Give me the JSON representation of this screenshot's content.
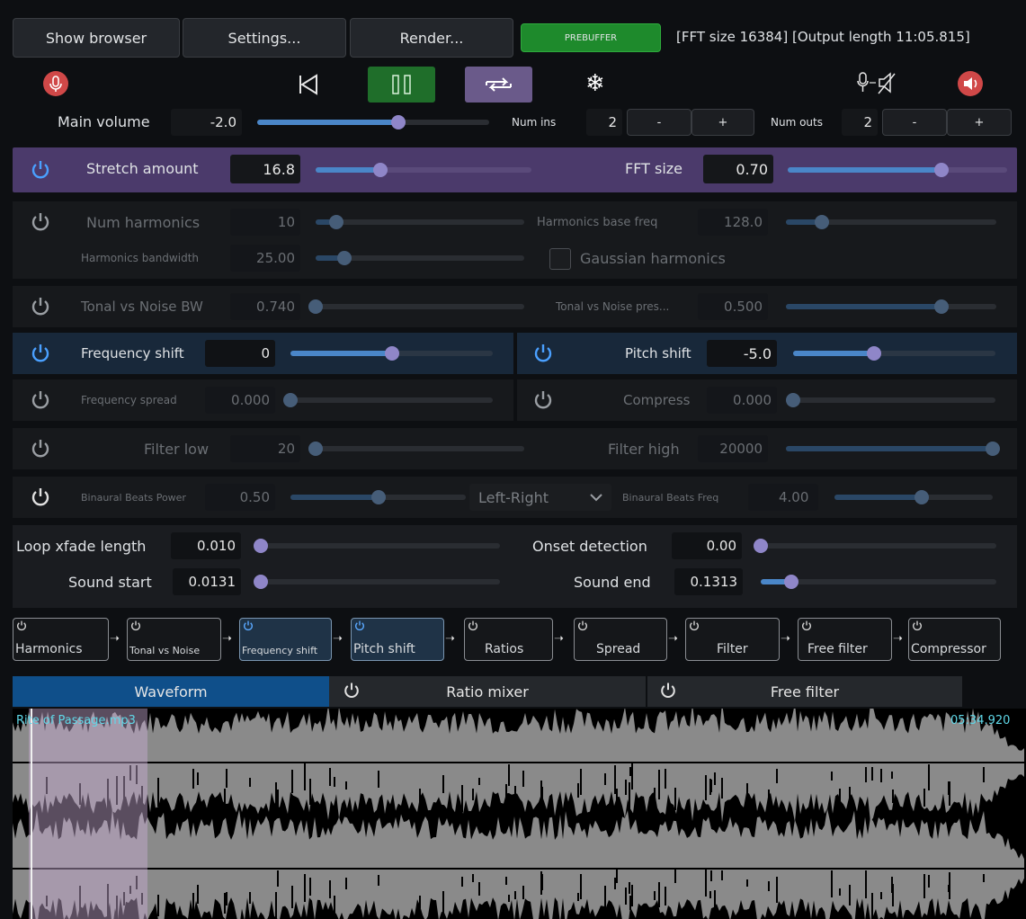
{
  "toolbar": {
    "show_browser": "Show browser",
    "settings": "Settings...",
    "render": "Render...",
    "prebuffer": "PREBUFFER",
    "status": "[FFT size 16384] [Output length 11:05.815]"
  },
  "colors": {
    "accent_blue": "#4a86c8",
    "thumb": "#8f86c8",
    "prebuffer_green": "#1e8a2c",
    "header_purple": "#4b3a6b",
    "play_green": "#1f6e2a",
    "loop_purple": "#6a5a8a",
    "waveform_grey": "#8a8a8a",
    "red_icon": "#e05050"
  },
  "transport": {
    "mic_icon": "mic-record-icon",
    "rewind_icon": "skip-back-icon",
    "pause_icon": "pause-icon",
    "loop_icon": "loop-icon",
    "freeze_icon": "snowflake-icon",
    "pass_icon": "mic-to-speaker-icon",
    "mute_icon": "speaker-icon"
  },
  "volume": {
    "label": "Main volume",
    "value": "-2.0",
    "level": 0.61
  },
  "ins": {
    "label": "Num ins",
    "value": "2",
    "minus": "-",
    "plus": "+"
  },
  "outs": {
    "label": "Num outs",
    "value": "2",
    "minus": "-",
    "plus": "+"
  },
  "stretch": {
    "label": "Stretch amount",
    "value": "16.8",
    "level": 0.3
  },
  "fft": {
    "label": "FFT size",
    "value": "0.70",
    "level": 0.7
  },
  "harmonics": {
    "num_label": "Num harmonics",
    "num_value": "10",
    "num_level": 0.1,
    "base_label": "Harmonics base freq",
    "base_value": "128.0",
    "base_level": 0.17,
    "bw_label": "Harmonics bandwidth",
    "bw_value": "25.00",
    "bw_level": 0.14,
    "gauss_label": "Gaussian harmonics"
  },
  "tonal": {
    "bw_label": "Tonal vs Noise BW",
    "bw_value": "0.740",
    "bw_level": 0.0,
    "pres_label": "Tonal vs Noise pres...",
    "pres_value": "0.500",
    "pres_level": 0.74
  },
  "freqshift": {
    "label": "Frequency shift",
    "value": "0",
    "level": 0.5
  },
  "pitchshift": {
    "label": "Pitch shift",
    "value": "-5.0",
    "level": 0.4
  },
  "spread": {
    "label": "Frequency spread",
    "value": "0.000",
    "level": 0.0
  },
  "compress": {
    "label": "Compress",
    "value": "0.000",
    "level": 0.0
  },
  "filter": {
    "low_label": "Filter low",
    "low_value": "20",
    "low_level": 0.0,
    "high_label": "Filter high",
    "high_value": "20000",
    "high_level": 1.0
  },
  "binaural": {
    "power_label": "Binaural Beats Power",
    "power_value": "0.50",
    "power_level": 0.5,
    "mode": "Left-Right",
    "freq_label": "Binaural Beats Freq",
    "freq_value": "4.00",
    "freq_level": 0.55
  },
  "loop": {
    "xfade_label": "Loop xfade length",
    "xfade_value": "0.010",
    "xfade_level": 0.0,
    "onset_label": "Onset detection",
    "onset_value": "0.00",
    "onset_level": 0.0,
    "start_label": "Sound start",
    "start_value": "0.0131",
    "start_level": 0.0,
    "end_label": "Sound end",
    "end_value": "0.1313",
    "end_level": 0.13
  },
  "chain": [
    "Harmonics",
    "Tonal vs Noise",
    "Frequency shift",
    "Pitch shift",
    "Ratios",
    "Spread",
    "Filter",
    "Free filter",
    "Compressor"
  ],
  "tabs": {
    "waveform": "Waveform",
    "ratio": "Ratio mixer",
    "free": "Free filter"
  },
  "wave": {
    "file": "Rite of Passage.mp3",
    "time": "05:34.920"
  }
}
